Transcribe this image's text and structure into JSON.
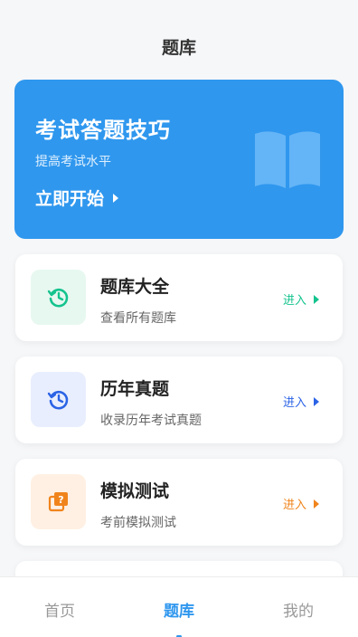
{
  "header": {
    "title": "题库"
  },
  "hero": {
    "title": "考试答题技巧",
    "subtitle": "提高考试水平",
    "start_label": "立即开始",
    "bg_color": "#2f97ee"
  },
  "cards": [
    {
      "title": "题库大全",
      "subtitle": "查看所有题库",
      "enter": "进入",
      "icon": "history-clock-icon",
      "accent": "#14c38e",
      "icon_bg": "#e7f8f0"
    },
    {
      "title": "历年真题",
      "subtitle": "收录历年考试真题",
      "enter": "进入",
      "icon": "history-clock-icon",
      "accent": "#2b63e6",
      "icon_bg": "#e8eefd"
    },
    {
      "title": "模拟测试",
      "subtitle": "考前模拟测试",
      "enter": "进入",
      "icon": "question-stack-icon",
      "accent": "#f0841c",
      "icon_bg": "#fff0e3"
    }
  ],
  "tabbar": {
    "tabs": [
      {
        "label": "首页",
        "active": false
      },
      {
        "label": "题库",
        "active": true
      },
      {
        "label": "我的",
        "active": false
      }
    ]
  }
}
